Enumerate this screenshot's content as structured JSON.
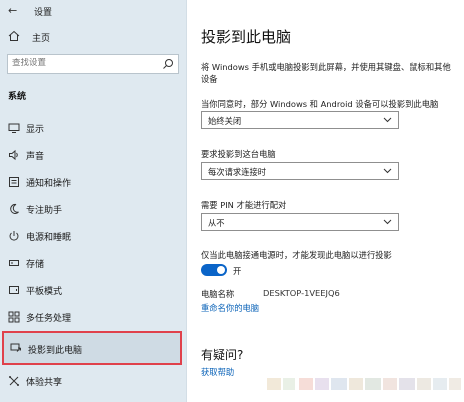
{
  "sidebar": {
    "app_title": "设置",
    "home_label": "主页",
    "search_placeholder": "查找设置",
    "section_label": "系统",
    "items": [
      {
        "label": "显示"
      },
      {
        "label": "声音"
      },
      {
        "label": "通知和操作"
      },
      {
        "label": "专注助手"
      },
      {
        "label": "电源和睡眠"
      },
      {
        "label": "存储"
      },
      {
        "label": "平板模式"
      },
      {
        "label": "多任务处理"
      },
      {
        "label": "投影到此电脑"
      },
      {
        "label": "体验共享"
      }
    ]
  },
  "main": {
    "title": "投影到此电脑",
    "description": "将 Windows 手机或电脑投影到此屏幕，并使用其键盘、鼠标和其他设备",
    "q1_label": "当你同意时，部分 Windows 和 Android 设备可以投影到此电脑",
    "q1_value": "始终关闭",
    "q2_label": "要求投影到这台电脑",
    "q2_value": "每次请求连接时",
    "q3_label": "需要 PIN 才能进行配对",
    "q3_value": "从不",
    "toggle_desc": "仅当此电脑接通电源时，才能发现此电脑以进行投影",
    "toggle_state": "开",
    "pc_name_label": "电脑名称",
    "pc_name_value": "DESKTOP-1VEEJQ6",
    "rename_link": "重命名你的电脑",
    "help_title": "有疑问?",
    "help_link": "获取帮助"
  },
  "colors": {
    "sidebar_bg": "#dfe9f0",
    "accent": "#0a64c8",
    "link": "#0b63b8",
    "highlight_border": "#e0414b"
  }
}
